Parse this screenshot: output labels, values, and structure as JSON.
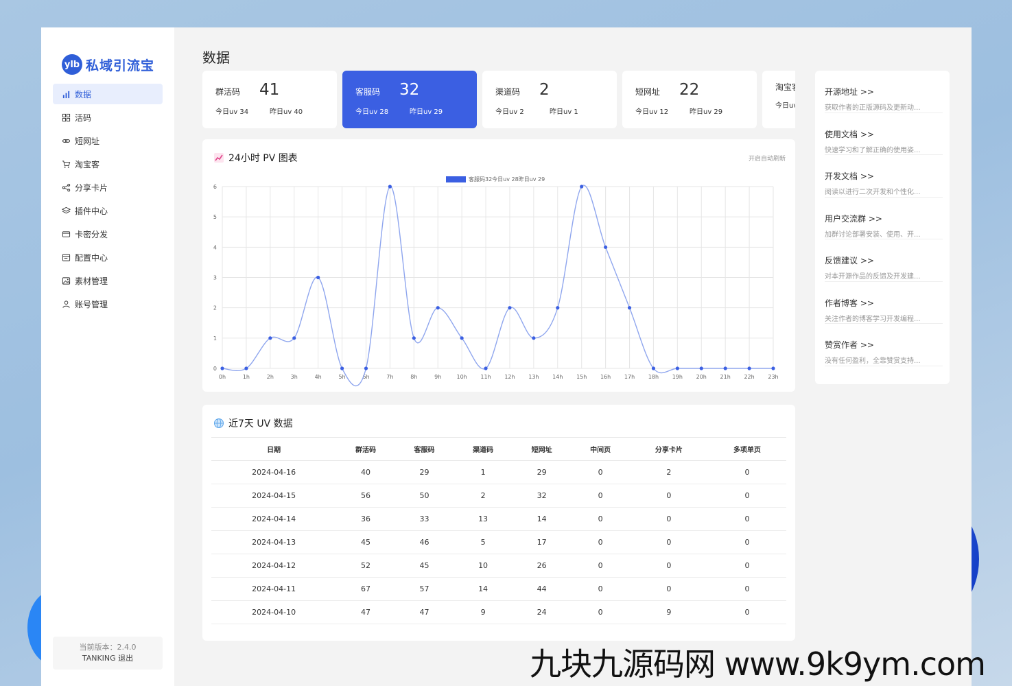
{
  "app": {
    "logo_badge": "ylb",
    "logo_text": "私域引流宝"
  },
  "sidebar": {
    "items": [
      {
        "label": "数据",
        "icon": "bar-chart-icon"
      },
      {
        "label": "活码",
        "icon": "grid-icon"
      },
      {
        "label": "短网址",
        "icon": "link-icon"
      },
      {
        "label": "淘宝客",
        "icon": "cart-icon"
      },
      {
        "label": "分享卡片",
        "icon": "share-icon"
      },
      {
        "label": "插件中心",
        "icon": "layers-icon"
      },
      {
        "label": "卡密分发",
        "icon": "card-icon"
      },
      {
        "label": "配置中心",
        "icon": "config-icon"
      },
      {
        "label": "素材管理",
        "icon": "image-icon"
      },
      {
        "label": "账号管理",
        "icon": "user-icon"
      }
    ],
    "version_line": "当前版本：2.4.0",
    "user_line": "TANKING 退出"
  },
  "page": {
    "title": "数据"
  },
  "stats": [
    {
      "name": "群活码",
      "value": "41",
      "today": "今日uv 34",
      "yesterday": "昨日uv 40"
    },
    {
      "name": "客服码",
      "value": "32",
      "today": "今日uv 28",
      "yesterday": "昨日uv 29"
    },
    {
      "name": "渠道码",
      "value": "2",
      "today": "今日uv 2",
      "yesterday": "昨日uv 1"
    },
    {
      "name": "短网址",
      "value": "22",
      "today": "今日uv 12",
      "yesterday": "昨日uv 29"
    },
    {
      "name": "淘宝客",
      "value": "",
      "today": "今日uv",
      "yesterday": ""
    }
  ],
  "chart_panel": {
    "title": "24小时 PV 图表",
    "auto_refresh": "开启自动刷新"
  },
  "chart_data": {
    "type": "line",
    "x": [
      "0h",
      "1h",
      "2h",
      "3h",
      "4h",
      "5h",
      "6h",
      "7h",
      "8h",
      "9h",
      "10h",
      "11h",
      "12h",
      "13h",
      "14h",
      "15h",
      "16h",
      "17h",
      "18h",
      "19h",
      "20h",
      "21h",
      "22h",
      "23h"
    ],
    "series": [
      {
        "name": "客服码32今日uv 28昨日uv 29",
        "values": [
          0,
          0,
          1,
          1,
          3,
          0,
          0,
          6,
          1,
          2,
          1,
          0,
          2,
          1,
          2,
          6,
          4,
          2,
          0,
          0,
          0,
          0,
          0,
          0
        ]
      }
    ],
    "yticks": [
      0,
      1,
      2,
      3,
      4,
      5,
      6
    ],
    "ylim": [
      0,
      6
    ],
    "grid": true,
    "legend": "top",
    "color": "#3b5fe2"
  },
  "table_panel": {
    "title": "近7天 UV 数据",
    "columns": [
      "日期",
      "群活码",
      "客服码",
      "渠道码",
      "短网址",
      "中间页",
      "分享卡片",
      "多项单页"
    ],
    "rows": [
      [
        "2024-04-16",
        "40",
        "29",
        "1",
        "29",
        "0",
        "2",
        "0"
      ],
      [
        "2024-04-15",
        "56",
        "50",
        "2",
        "32",
        "0",
        "0",
        "0"
      ],
      [
        "2024-04-14",
        "36",
        "33",
        "13",
        "14",
        "0",
        "0",
        "0"
      ],
      [
        "2024-04-13",
        "45",
        "46",
        "5",
        "17",
        "0",
        "0",
        "0"
      ],
      [
        "2024-04-12",
        "52",
        "45",
        "10",
        "26",
        "0",
        "0",
        "0"
      ],
      [
        "2024-04-11",
        "67",
        "57",
        "14",
        "44",
        "0",
        "0",
        "0"
      ],
      [
        "2024-04-10",
        "47",
        "47",
        "9",
        "24",
        "0",
        "9",
        "0"
      ]
    ]
  },
  "links": [
    {
      "title": "开源地址 >>",
      "desc": "获取作者的正版源码及更新动..."
    },
    {
      "title": "使用文档 >>",
      "desc": "快速学习和了解正确的使用姿..."
    },
    {
      "title": "开发文档 >>",
      "desc": "阅读以进行二次开发和个性化..."
    },
    {
      "title": "用户交流群 >>",
      "desc": "加群讨论部署安装、使用、开..."
    },
    {
      "title": "反馈建议 >>",
      "desc": "对本开源作品的反馈及开发建..."
    },
    {
      "title": "作者博客 >>",
      "desc": "关注作者的博客学习开发编程..."
    },
    {
      "title": "赞赏作者 >>",
      "desc": "没有任何盈利，全靠赞赏支持..."
    }
  ],
  "watermark": "九块九源码网 www.9k9ym.com"
}
